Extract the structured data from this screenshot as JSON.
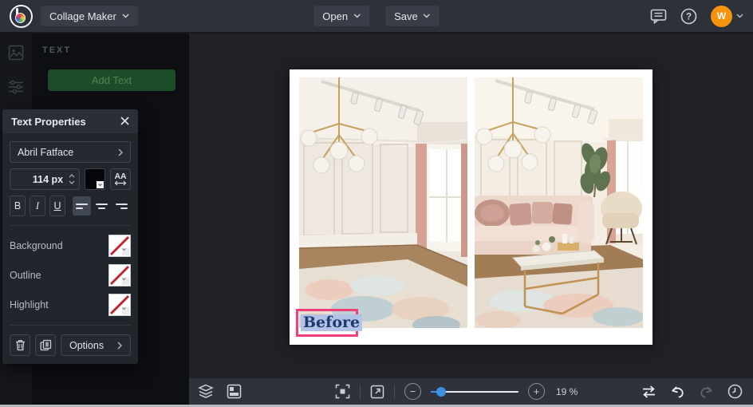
{
  "topbar": {
    "app_name": "Collage Maker",
    "open_label": "Open",
    "save_label": "Save",
    "avatar_initial": "W"
  },
  "sidebar": {
    "section_label": "TEXT",
    "add_text_label": "Add Text"
  },
  "text_properties": {
    "title": "Text Properties",
    "font_name": "Abril Fatface",
    "font_size": "114 px",
    "bold": "B",
    "italic": "I",
    "underline": "U",
    "letter_spacing": "AA",
    "background_label": "Background",
    "outline_label": "Outline",
    "highlight_label": "Highlight",
    "options_label": "Options"
  },
  "canvas": {
    "selected_text": "Before"
  },
  "bottom_toolbar": {
    "zoom_percent": "19 %"
  },
  "colors": {
    "selection_pink": "#f23f78",
    "slider_blue": "#3e8ee2",
    "avatar_orange": "#f6930c",
    "text_color_swatch": "#000000",
    "topbar_bg": "#2d313a",
    "canvas_bg": "#1f2126"
  }
}
